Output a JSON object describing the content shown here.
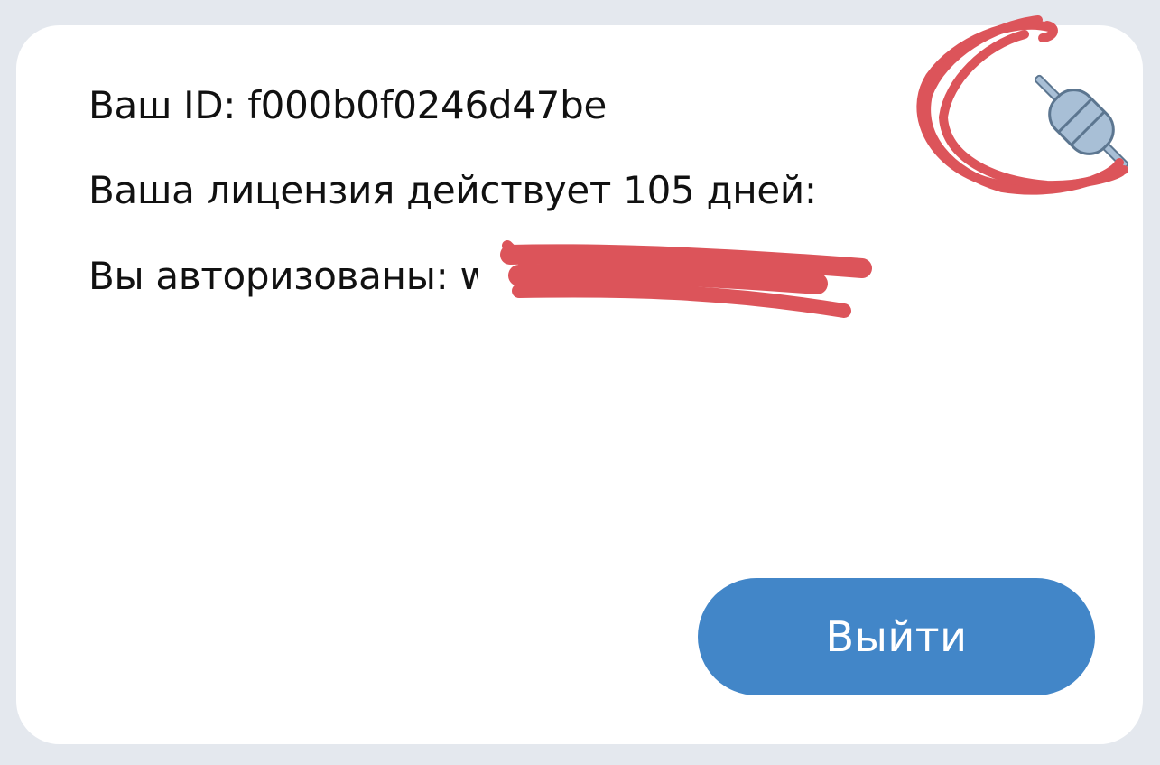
{
  "account": {
    "id_label": "Ваш ID:",
    "id_value": "f000b0f0246d47be",
    "license_text": "Ваша лицензия действует 105 дней:",
    "authorized_label": "Вы авторизованы:",
    "authorized_user_visible": "w"
  },
  "icons": {
    "status": "plug-icon",
    "status_color": "#a8bfd6"
  },
  "actions": {
    "logout_label": "Выйти",
    "logout_color": "#4286c8"
  },
  "annotations": {
    "markup_color": "#dc545a"
  }
}
